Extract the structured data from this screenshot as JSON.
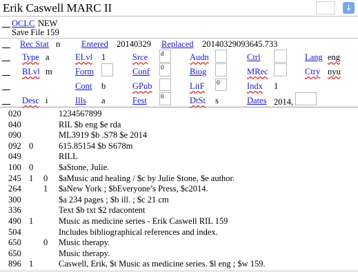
{
  "window": {
    "title": "Erik Caswell MARC II"
  },
  "header": {
    "oclc_label": "OCLC",
    "oclc_value": "NEW",
    "save_file": "Save File 159"
  },
  "fixed_fields": {
    "rec_stat_label": "Rec Stat",
    "rec_stat": "n",
    "entered_label": "Entered",
    "entered": "20140329",
    "replaced_label": "Replaced",
    "replaced": "20140329093645.733",
    "type_label": "Type",
    "type": "a",
    "elvl_label": "ELvl",
    "elvl": "1",
    "srce_label": "Srce",
    "srce": "d",
    "audn_label": "Audn",
    "audn": "",
    "ctrl_label": "Ctrl",
    "ctrl": "",
    "lang_label": "Lang",
    "lang": "eng",
    "blvl_label": "BLvl",
    "blvl": "m",
    "form_label": "Form",
    "form": "",
    "conf_label": "Conf",
    "conf": "0",
    "biog_label": "Biog",
    "biog": "",
    "mrec_label": "MRec",
    "mrec": "",
    "ctry_label": "Ctry",
    "ctry": "nyu",
    "cont_label": "Cont",
    "cont": "b",
    "gpub_label": "GPub",
    "gpub": "",
    "litf_label": "LitF",
    "litf": "0",
    "indx_label": "Indx",
    "indx": "1",
    "desc_label": "Desc",
    "desc": "i",
    "ills_label": "Ills",
    "ills": "a",
    "fest_label": "Fest",
    "fest": "0",
    "dtst_label": "DtSt",
    "dtst": "s",
    "dates_label": "Dates",
    "dates": "2014,"
  },
  "fields": [
    {
      "tag": "020",
      "ind1": "",
      "ind2": "",
      "value": "1234567899"
    },
    {
      "tag": "040",
      "ind1": "",
      "ind2": "",
      "value": "RIL $b eng $e rda"
    },
    {
      "tag": "090",
      "ind1": "",
      "ind2": "",
      "value": "ML3919 $b .S78 $e 2014"
    },
    {
      "tag": "092",
      "ind1": "0",
      "ind2": "",
      "value": "615.85154 $b S678m"
    },
    {
      "tag": "049",
      "ind1": "",
      "ind2": "",
      "value": "RILL"
    },
    {
      "tag": "100",
      "ind1": "0",
      "ind2": "",
      "value": "$aStone, Julie."
    },
    {
      "tag": "245",
      "ind1": "1",
      "ind2": "0",
      "value": "$aMusic and healing / $c by Julie Stone, $e author."
    },
    {
      "tag": "264",
      "ind1": "",
      "ind2": "1",
      "value": "$aNew York ; $bEveryone’s Press, $c2014."
    },
    {
      "tag": "300",
      "ind1": "",
      "ind2": "",
      "value": "$a 234 pages ; $b ill. ; $c 21 cm"
    },
    {
      "tag": "336",
      "ind1": "",
      "ind2": "",
      "value": "Text $b txt $2 rdacontent"
    },
    {
      "tag": "490",
      "ind1": "1",
      "ind2": "",
      "value": "Music as medicine series - Erik Caswell RIL 159"
    },
    {
      "tag": "504",
      "ind1": "",
      "ind2": "",
      "value": "Includes bibliographical references and index."
    },
    {
      "tag": "650",
      "ind1": "",
      "ind2": "0",
      "value": "Music therapy."
    },
    {
      "tag": "650",
      "ind1": "",
      "ind2": "",
      "value": "Music therapy."
    },
    {
      "tag": "896",
      "ind1": "1",
      "ind2": "",
      "value": "Caswell, Erik, $t Music as medicine series. $l eng ; $w 159."
    }
  ]
}
